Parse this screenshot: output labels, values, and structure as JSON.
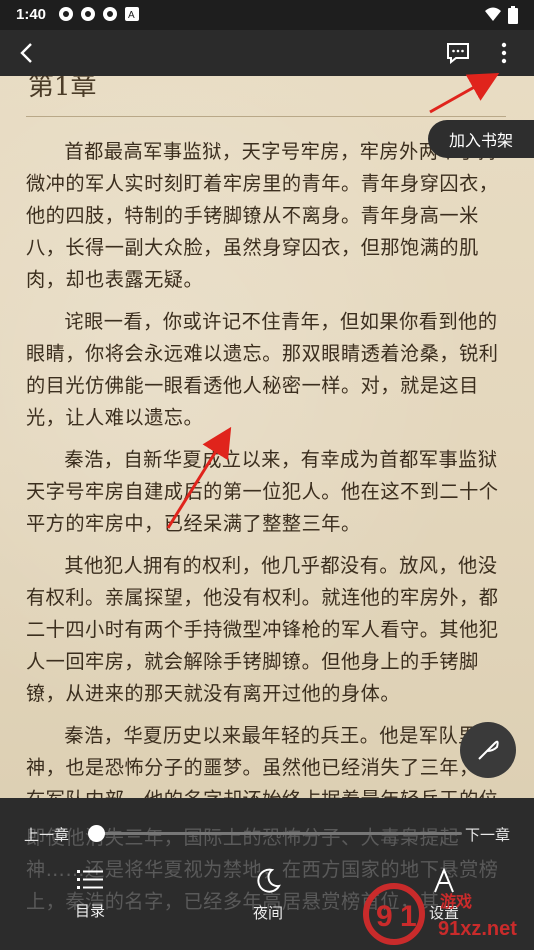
{
  "status": {
    "time": "1:40"
  },
  "reader": {
    "chapter_title": "第1章",
    "paragraphs": [
      "首都最高军事监狱，天字号牢房，牢房外两个手持微冲的军人实时刻盯着牢房里的青年。青年身穿囚衣，他的四肢，特制的手铐脚镣从不离身。青年身高一米八，长得一副大众脸，虽然身穿囚衣，但那饱满的肌肉，却也表露无疑。",
      "诧眼一看，你或许记不住青年，但如果你看到他的眼睛，你将会永远难以遗忘。那双眼睛透着沧桑，锐利的目光仿佛能一眼看透他人秘密一样。对，就是这目光，让人难以遗忘。",
      "秦浩，自新华夏成立以来，有幸成为首都军事监狱天字号牢房自建成后的第一位犯人。他在这不到二十个平方的牢房中，已经呆满了整整三年。",
      "其他犯人拥有的权利，他几乎都没有。放风，他没有权利。亲属探望，他没有权利。就连他的牢房外，都二十四小时有两个手持微型冲锋枪的军人看守。其他犯人一回牢房，就会解除手铐脚镣。但他身上的手铐脚镣，从进来的那天就没有离开过他的身体。",
      "秦浩，华夏历史以来最年轻的兵王。他是军队里的神，也是恐怖分子的噩梦。虽然他已经消失了三年，但在军队内部，他的名字却还始终占据着最年轻兵王的位置。"
    ],
    "ghost_text": "即使他消失三年，国际上的恐怖分子、大毒枭提起神……还是将华夏视为禁地，在西方国家的地下悬赏榜上，秦浩的名字，已经多年高居悬赏榜首位，其"
  },
  "actions": {
    "add_to_shelf": "加入书架"
  },
  "bottom": {
    "prev_chapter": "上一章",
    "next_chapter": "下一章",
    "progress": 0.0,
    "toc_label": "目录",
    "night_label": "夜间",
    "settings_label": "设置"
  },
  "watermark": {
    "brand": "91xz.net",
    "tag": "游戏"
  },
  "colors": {
    "accent_arrow": "#e0241c",
    "panel": "#2c2c2c"
  }
}
